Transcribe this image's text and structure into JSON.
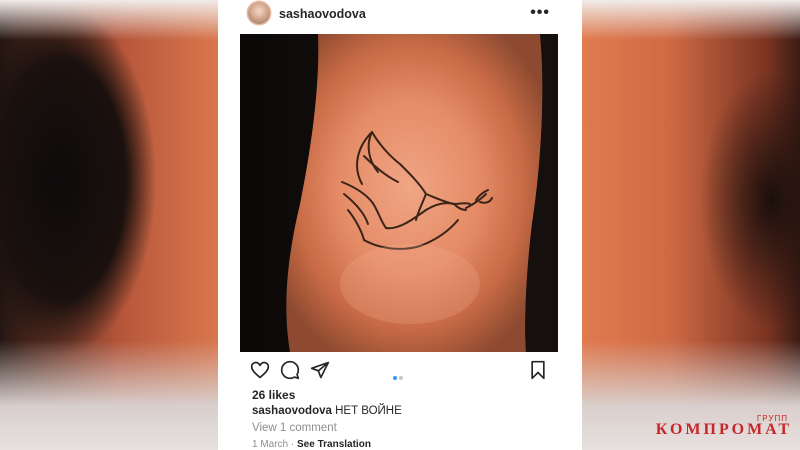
{
  "post": {
    "username": "sashaovodova",
    "more_icon": "ellipsis-icon",
    "likes": "26 likes",
    "caption_user": "sashaovodova",
    "caption_text": " НЕТ ВОЙНЕ",
    "view_comments": "View 1 comment",
    "date": "1 March",
    "separator": " · ",
    "see_translation": "See Translation",
    "carousel": {
      "count": 2,
      "active_index": 0
    }
  },
  "actions": {
    "like_icon": "heart-icon",
    "comment_icon": "comment-icon",
    "share_icon": "paper-plane-icon",
    "save_icon": "bookmark-icon"
  },
  "watermark": {
    "sub": "ГРУПП",
    "main": "КОМПРОМАТ"
  },
  "colors": {
    "accent_blue": "#3897f0",
    "inactive_dot": "#c7c7c7",
    "text_primary": "#262626",
    "text_secondary": "#8e8e8e",
    "watermark_red": "#c8262a"
  }
}
